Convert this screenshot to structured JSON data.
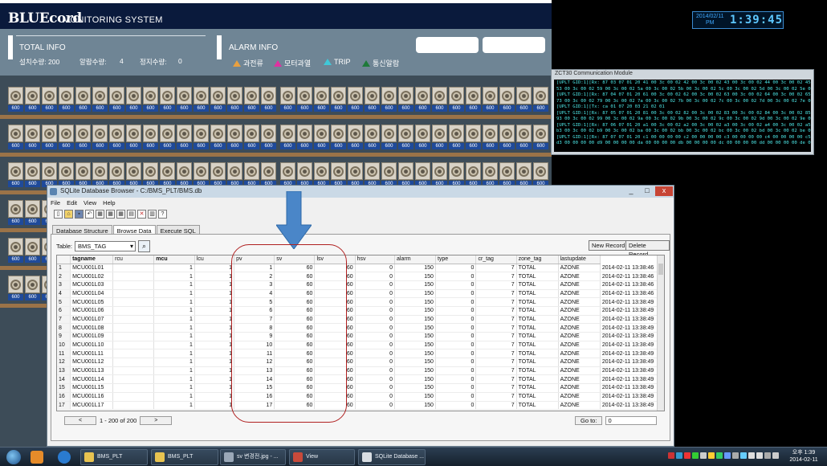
{
  "monitor": {
    "brand": "BLUEcord",
    "subtitle": "MONITORING SYSTEM",
    "total_info": "TOTAL INFO",
    "installed_label": "설치수량: 200",
    "alarm_count_label": "알람수량:",
    "alarm_count": "4",
    "stop_count_label": "정지수량:",
    "stop_count": "0",
    "alarm_info": "ALARM INFO",
    "alarms": [
      {
        "label": "과전류",
        "color": "#e8a040"
      },
      {
        "label": "모터과열",
        "color": "#e030a0"
      },
      {
        "label": "TRIP",
        "color": "#40c8d8"
      },
      {
        "label": "통신알람",
        "color": "#1e7a3a"
      }
    ],
    "fan_label": "600"
  },
  "clock": {
    "date": "2014/02/11",
    "ampm": "PM",
    "time": "1:39:45"
  },
  "comm": {
    "title": "ZCT30 Communication Module",
    "lines": [
      "[UPLT GID:1][Rx: 87 03 07 01 20 41 00 3c 00 02 42 00 3c 00 02 43 00 3c 00 02 44 00 3c 00 02 45 00",
      "53 00 3c 00 02 59 00 3c 00 02 5a 00 3c 00 02 5b 00 3c 00 02 5c 00 3c 00 02 5d 00 3c 00 02 5e 00",
      "[UPLT GID:1][Rx: 87 04 07 01 20 61 00 3c 00 02 62 00 3c 00 02 63 00 3c 00 02 64 00 3c 00 02 65 00",
      "73 00 3c 00 02 79 00 3c 00 02 7a 00 3c 00 02 7b 00 3c 00 02 7c 00 3c 00 02 7d 00 3c 00 02 7e 00",
      "[UPLT GID:1][Tx: ca 01 07 20 03 21 02 01",
      "[UPLT GID:1][Rx: 87 05 07 01 20 81 00 3c 00 02 82 00 3c 00 02 83 00 3c 00 02 84 00 3c 00 02 85 00",
      "93 00 3c 00 02 99 00 3c 00 02 9a 00 3c 00 02 9b 00 3c 00 02 9c 00 3c 00 02 9d 00 3c 00 02 9e 00",
      "[UPLT GID:1][Rx: 87 06 07 01 20 a1 00 3c 00 02 a2 00 3c 00 02 a3 00 3c 00 02 a4 00 3c 00 02 a5 00",
      "b3 00 3c 00 02 b9 00 3c 00 02 ba 00 3c 00 02 bb 00 3c 00 02 bc 00 3c 00 02 bd 00 3c 00 02 be 00",
      "[UPLT GID:1][Rx: 87 07 07 01 20 c1 00 00 00 00 c2 00 00 00 00 c3 00 00 00 00 c4 00 00 00 00 c5 00",
      "d3 00 00 00 00 d9 00 00 00 00 da 00 00 00 00 db 00 00 00 00 dc 00 00 00 00 dd 00 00 00 00 de 00"
    ]
  },
  "sql": {
    "title": "SQLite Database Browser - C:/BMS_PLT/BMS.db",
    "window_buttons": [
      "_",
      "□",
      "x"
    ],
    "menu": [
      "File",
      "Edit",
      "View",
      "Help"
    ],
    "toolbar_icons": [
      "new-icon",
      "open-icon",
      "save-icon",
      "undo-icon",
      "create-table-icon",
      "delete-table-icon",
      "modify-table-icon",
      "create-index-icon",
      "delete-index-icon",
      "sql-log-icon",
      "whats-this-icon"
    ],
    "tabs": [
      "Database Structure",
      "Browse Data",
      "Execute SQL"
    ],
    "active_tab": "Browse Data",
    "table_label": "Table:",
    "table_value": "BMS_TAG",
    "new_record": "New Record",
    "delete_record": "Delete Record",
    "columns": [
      "tagname",
      "rcu",
      "mcu",
      "lcu",
      "pv",
      "sv",
      "lsv",
      "hsv",
      "alarm",
      "type",
      "cr_tag",
      "zone_tag",
      "lastupdate"
    ],
    "rows": [
      [
        "1",
        "MCU001L01",
        "",
        "1",
        "1",
        "1",
        "60",
        "60",
        "0",
        "150",
        "0",
        "7",
        "TOTAL",
        "AZONE",
        "2014-02-11 13:38:46"
      ],
      [
        "2",
        "MCU001L02",
        "",
        "1",
        "1",
        "2",
        "60",
        "60",
        "0",
        "150",
        "0",
        "7",
        "TOTAL",
        "AZONE",
        "2014-02-11 13:38:46"
      ],
      [
        "3",
        "MCU001L03",
        "",
        "1",
        "1",
        "3",
        "60",
        "60",
        "0",
        "150",
        "0",
        "7",
        "TOTAL",
        "AZONE",
        "2014-02-11 13:38:46"
      ],
      [
        "4",
        "MCU001L04",
        "",
        "1",
        "1",
        "4",
        "60",
        "60",
        "0",
        "150",
        "0",
        "7",
        "TOTAL",
        "AZONE",
        "2014-02-11 13:38:46"
      ],
      [
        "5",
        "MCU001L05",
        "",
        "1",
        "1",
        "5",
        "60",
        "60",
        "0",
        "150",
        "0",
        "7",
        "TOTAL",
        "AZONE",
        "2014-02-11 13:38:49"
      ],
      [
        "6",
        "MCU001L06",
        "",
        "1",
        "1",
        "6",
        "60",
        "60",
        "0",
        "150",
        "0",
        "7",
        "TOTAL",
        "AZONE",
        "2014-02-11 13:38:49"
      ],
      [
        "7",
        "MCU001L07",
        "",
        "1",
        "1",
        "7",
        "60",
        "60",
        "0",
        "150",
        "0",
        "7",
        "TOTAL",
        "AZONE",
        "2014-02-11 13:38:49"
      ],
      [
        "8",
        "MCU001L08",
        "",
        "1",
        "1",
        "8",
        "60",
        "60",
        "0",
        "150",
        "0",
        "7",
        "TOTAL",
        "AZONE",
        "2014-02-11 13:38:49"
      ],
      [
        "9",
        "MCU001L09",
        "",
        "1",
        "1",
        "9",
        "60",
        "60",
        "0",
        "150",
        "0",
        "7",
        "TOTAL",
        "AZONE",
        "2014-02-11 13:38:49"
      ],
      [
        "10",
        "MCU001L10",
        "",
        "1",
        "1",
        "10",
        "60",
        "60",
        "0",
        "150",
        "0",
        "7",
        "TOTAL",
        "AZONE",
        "2014-02-11 13:38:49"
      ],
      [
        "11",
        "MCU001L11",
        "",
        "1",
        "1",
        "11",
        "60",
        "60",
        "0",
        "150",
        "0",
        "7",
        "TOTAL",
        "AZONE",
        "2014-02-11 13:38:49"
      ],
      [
        "12",
        "MCU001L12",
        "",
        "1",
        "1",
        "12",
        "60",
        "60",
        "0",
        "150",
        "0",
        "7",
        "TOTAL",
        "AZONE",
        "2014-02-11 13:38:49"
      ],
      [
        "13",
        "MCU001L13",
        "",
        "1",
        "1",
        "13",
        "60",
        "60",
        "0",
        "150",
        "0",
        "7",
        "TOTAL",
        "AZONE",
        "2014-02-11 13:38:49"
      ],
      [
        "14",
        "MCU001L14",
        "",
        "1",
        "1",
        "14",
        "60",
        "60",
        "0",
        "150",
        "0",
        "7",
        "TOTAL",
        "AZONE",
        "2014-02-11 13:38:49"
      ],
      [
        "15",
        "MCU001L15",
        "",
        "1",
        "1",
        "15",
        "60",
        "60",
        "0",
        "150",
        "0",
        "7",
        "TOTAL",
        "AZONE",
        "2014-02-11 13:38:49"
      ],
      [
        "16",
        "MCU001L16",
        "",
        "1",
        "1",
        "16",
        "60",
        "60",
        "0",
        "150",
        "0",
        "7",
        "TOTAL",
        "AZONE",
        "2014-02-11 13:38:49"
      ],
      [
        "17",
        "MCU001L17",
        "",
        "1",
        "1",
        "17",
        "60",
        "60",
        "0",
        "150",
        "0",
        "7",
        "TOTAL",
        "AZONE",
        "2014-02-11 13:38:49"
      ]
    ],
    "page_info": "1 - 200 of 200",
    "prev_label": "<",
    "next_label": ">",
    "goto_label": "Go to:",
    "goto_value": "0"
  },
  "taskbar": {
    "items": [
      {
        "label": "BMS_PLT",
        "icon": "folder-icon",
        "color": "#e8c350"
      },
      {
        "label": "BMS_PLT",
        "icon": "folder-icon",
        "color": "#e8c350"
      },
      {
        "label": "sv 변경전.jpg - ...",
        "icon": "image-viewer-icon",
        "color": "#9aa8b8"
      },
      {
        "label": "View",
        "icon": "app-view-icon",
        "color": "#c84a3a"
      },
      {
        "label": "SQLite Database ...",
        "icon": "sqlite-icon",
        "color": "#d8dde2"
      }
    ],
    "clock_ampm": "오후 1:39",
    "clock_date": "2014-02-11"
  },
  "colors": {
    "monitor_bg": "#3d4c58",
    "header_bg": "#0a1a3c",
    "info_bg": "#6f8595",
    "fan_label_bg": "#1f4a9a",
    "shelf": "#9b7348",
    "annotation_arrow": "#4a86c8",
    "annotation_ellipse": "#b02020"
  }
}
